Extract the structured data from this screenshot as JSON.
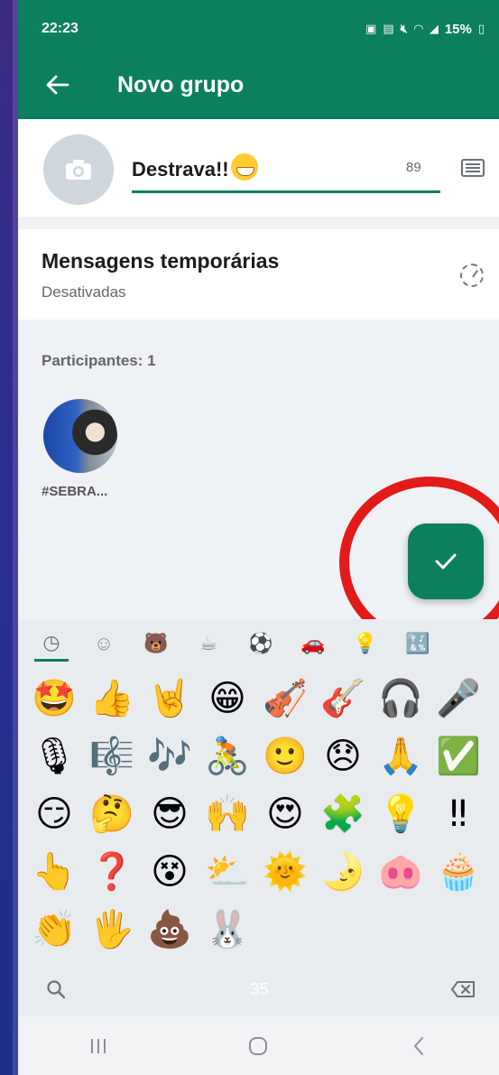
{
  "status_bar": {
    "time": "22:23",
    "battery": "15%",
    "icons": [
      "media-icon",
      "gallery-icon",
      "mute-icon",
      "wifi-icon",
      "signal-icon",
      "battery-icon"
    ]
  },
  "toolbar": {
    "title": "Novo grupo",
    "back_icon": "arrow-left-icon"
  },
  "group": {
    "name": "Destrava!!",
    "name_emoji": "😁",
    "char_count": "89",
    "photo_icon": "camera-icon",
    "keyboard_icon": "keyboard-icon"
  },
  "temporary_messages": {
    "title": "Mensagens temporárias",
    "status": "Desativadas",
    "icon": "timer-icon"
  },
  "participants": {
    "label": "Participantes: 1",
    "items": [
      {
        "name": "#SEBRA..."
      }
    ]
  },
  "fab": {
    "icon": "check-icon"
  },
  "emoji_keyboard": {
    "tabs": [
      {
        "icon": "recent-icon",
        "glyph": "◷",
        "active": true
      },
      {
        "icon": "smiley-icon",
        "glyph": "☺"
      },
      {
        "icon": "animal-icon",
        "glyph": "🐻"
      },
      {
        "icon": "food-icon",
        "glyph": "☕"
      },
      {
        "icon": "activity-icon",
        "glyph": "⚽"
      },
      {
        "icon": "travel-icon",
        "glyph": "🚗"
      },
      {
        "icon": "objects-icon",
        "glyph": "💡"
      },
      {
        "icon": "symbols-icon",
        "glyph": "🔣"
      }
    ],
    "emojis": [
      "🤩",
      "👍",
      "🤘",
      "😁",
      "🎻",
      "🎸",
      "🎧",
      "🎤",
      "🎙",
      "🎼",
      "🎶",
      "🚴",
      "🙂",
      "😞",
      "🙏",
      "✅",
      "😏",
      "🤔",
      "😎",
      "🙌",
      "😍",
      "🧩",
      "💡",
      "‼",
      "👆",
      "❓",
      "😵",
      "⛅",
      "🌞",
      "🌛",
      "🐽",
      "🧁",
      "👏",
      "🖐",
      "💩",
      "🐰"
    ],
    "page": "35",
    "search_icon": "search-icon",
    "backspace_icon": "backspace-icon"
  },
  "nav_bar": {
    "recents_icon": "recents-icon",
    "home_icon": "home-icon",
    "back_icon": "nav-back-icon"
  },
  "colors": {
    "primary": "#0c7f5e",
    "highlight_circle": "#e21a1a"
  }
}
